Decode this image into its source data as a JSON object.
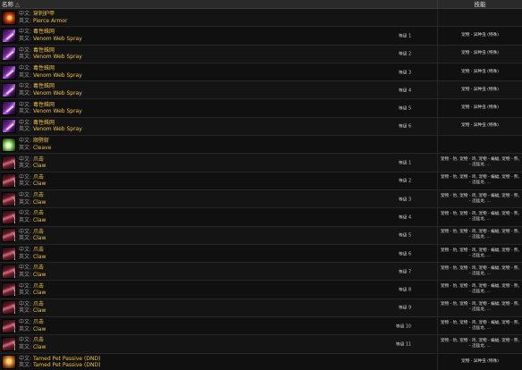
{
  "header": {
    "name_label": "名称",
    "sort_icon": "△",
    "skill_label": "技能"
  },
  "labels": {
    "zh": "中文:",
    "en": "英文:"
  },
  "rows": [
    {
      "icon": "pierce",
      "zh": "穿刺护甲",
      "en": "Pierce Armor",
      "rank": "",
      "skill": ""
    },
    {
      "icon": "venom",
      "zh": "毒性蛛网",
      "en": "Venom Web Spray",
      "rank": "等级 1",
      "skill": "宠物 - 异种虫 (特殊)"
    },
    {
      "icon": "venom",
      "zh": "毒性蛛网",
      "en": "Venom Web Spray",
      "rank": "等级 2",
      "skill": "宠物 - 异种虫 (特殊)"
    },
    {
      "icon": "venom",
      "zh": "毒性蛛网",
      "en": "Venom Web Spray",
      "rank": "等级 3",
      "skill": "宠物 - 异种虫 (特殊)"
    },
    {
      "icon": "venom",
      "zh": "毒性蛛网",
      "en": "Venom Web Spray",
      "rank": "等级 4",
      "skill": "宠物 - 异种虫 (特殊)"
    },
    {
      "icon": "venom",
      "zh": "毒性蛛网",
      "en": "Venom Web Spray",
      "rank": "等级 5",
      "skill": "宠物 - 异种虫 (特殊)"
    },
    {
      "icon": "venom",
      "zh": "毒性蛛网",
      "en": "Venom Web Spray",
      "rank": "等级 6",
      "skill": "宠物 - 异种虫 (特殊)"
    },
    {
      "icon": "cleave",
      "zh": "顺劈斩",
      "en": "Cleave",
      "rank": "",
      "skill": ""
    },
    {
      "icon": "claw",
      "zh": "爪击",
      "en": "Claw",
      "rank": "等级 1",
      "skill": "宠物 - 豹, 宠物 - 鸡, 宠物 - 蝙蝠, 宠物 - 熊, - 迅猛龙, ..."
    },
    {
      "icon": "claw",
      "zh": "爪击",
      "en": "Claw",
      "rank": "等级 2",
      "skill": "宠物 - 豹, 宠物 - 鸡, 宠物 - 蝙蝠, 宠物 - 熊, - 迅猛龙, ..."
    },
    {
      "icon": "claw",
      "zh": "爪击",
      "en": "Claw",
      "rank": "等级 3",
      "skill": "宠物 - 豹, 宠物 - 鸡, 宠物 - 蝙蝠, 宠物 - 熊, - 迅猛龙, ..."
    },
    {
      "icon": "claw",
      "zh": "爪击",
      "en": "Claw",
      "rank": "等级 4",
      "skill": "宠物 - 豹, 宠物 - 鸡, 宠物 - 蝙蝠, 宠物 - 熊, - 迅猛龙, ..."
    },
    {
      "icon": "claw",
      "zh": "爪击",
      "en": "Claw",
      "rank": "等级 5",
      "skill": "宠物 - 豹, 宠物 - 鸡, 宠物 - 蝙蝠, 宠物 - 熊, - 迅猛龙, ..."
    },
    {
      "icon": "claw",
      "zh": "爪击",
      "en": "Claw",
      "rank": "等级 6",
      "skill": "宠物 - 豹, 宠物 - 鸡, 宠物 - 蝙蝠, 宠物 - 熊, - 迅猛龙, ..."
    },
    {
      "icon": "claw",
      "zh": "爪击",
      "en": "Claw",
      "rank": "等级 7",
      "skill": "宠物 - 豹, 宠物 - 鸡, 宠物 - 蝙蝠, 宠物 - 熊, - 迅猛龙, ..."
    },
    {
      "icon": "claw",
      "zh": "爪击",
      "en": "Claw",
      "rank": "等级 8",
      "skill": "宠物 - 豹, 宠物 - 鸡, 宠物 - 蝙蝠, 宠物 - 熊, - 迅猛龙, ..."
    },
    {
      "icon": "claw",
      "zh": "爪击",
      "en": "Claw",
      "rank": "等级 9",
      "skill": "宠物 - 豹, 宠物 - 鸡, 宠物 - 蝙蝠, 宠物 - 熊, - 迅猛龙, ..."
    },
    {
      "icon": "claw",
      "zh": "爪击",
      "en": "Claw",
      "rank": "等级 10",
      "skill": "宠物 - 豹, 宠物 - 鸡, 宠物 - 蝙蝠, 宠物 - 熊, - 迅猛龙, ..."
    },
    {
      "icon": "claw",
      "zh": "爪击",
      "en": "Claw",
      "rank": "等级 11",
      "skill": "宠物 - 豹, 宠物 - 鸡, 宠物 - 蝙蝠, 宠物 - 熊, - 迅猛龙, ..."
    },
    {
      "icon": "tamed",
      "zh": "Tamed Pet Passive (DND)",
      "en": "Tamed Pet Passive (DND)",
      "rank": "",
      "skill": "宠物 - 异种虫 (特殊)"
    }
  ]
}
